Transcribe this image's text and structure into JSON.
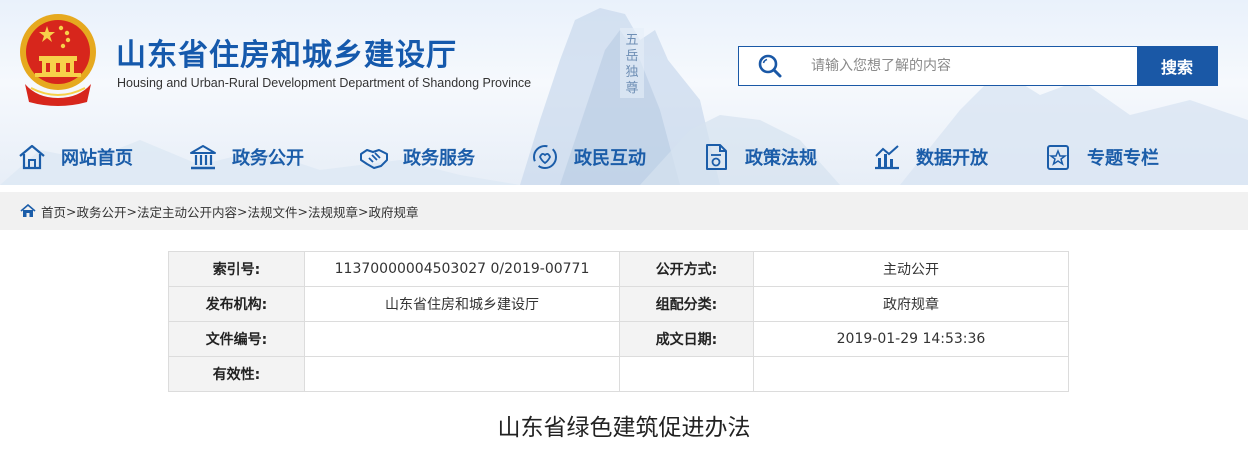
{
  "header": {
    "title": "山东省住房和城乡建设厅",
    "subtitle": "Housing and Urban-Rural Development Department of Shandong Province",
    "accent_color": "#1a58a6"
  },
  "search": {
    "placeholder": "请输入您想了解的内容",
    "button_label": "搜索",
    "icon": "search-icon"
  },
  "nav": {
    "items": [
      {
        "label": "网站首页",
        "icon": "home-icon"
      },
      {
        "label": "政务公开",
        "icon": "building-icon"
      },
      {
        "label": "政务服务",
        "icon": "handshake-icon"
      },
      {
        "label": "政民互动",
        "icon": "interaction-icon"
      },
      {
        "label": "政策法规",
        "icon": "document-icon"
      },
      {
        "label": "数据开放",
        "icon": "chart-icon"
      },
      {
        "label": "专题专栏",
        "icon": "star-doc-icon"
      }
    ]
  },
  "breadcrumb": {
    "items": [
      "首页",
      "政务公开",
      "法定主动公开内容",
      "法规文件",
      "法规规章",
      "政府规章"
    ],
    "separator": ">"
  },
  "meta": {
    "rows": [
      [
        "索引号:",
        "11370000004503027 0/2019-00771",
        "公开方式:",
        "主动公开"
      ],
      [
        "发布机构:",
        "山东省住房和城乡建设厅",
        "组配分类:",
        "政府规章"
      ],
      [
        "文件编号:",
        "",
        "成文日期:",
        "2019-01-29 14:53:36"
      ],
      [
        "有效性:",
        "",
        "",
        ""
      ]
    ]
  },
  "document": {
    "title": "山东省绿色建筑促进办法"
  }
}
